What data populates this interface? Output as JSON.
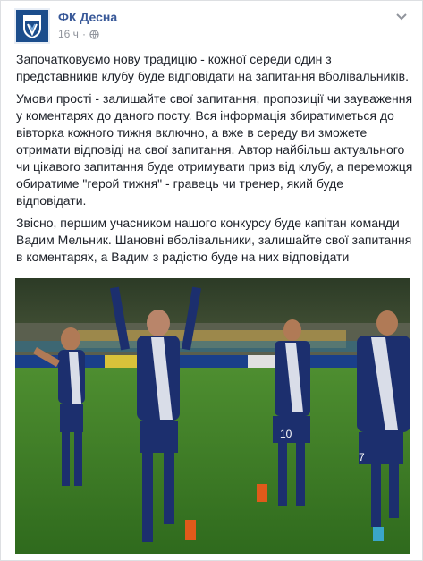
{
  "post": {
    "page_name": "ФК Десна",
    "timestamp": "16 ч",
    "privacy_icon": "globe-icon",
    "options_icon": "chevron-down-icon",
    "paragraphs": [
      "Започатковуємо нову традицію - кожної середи один з представників клубу буде відповідати на запитання вболівальників.",
      "Умови прості - залишайте свої запитання, пропозиції чи зауваження у коментарях до даного посту. Вся інформація збиратиметься до вівторка кожного тижня включно, а вже в середу ви зможете отримати відповіді на свої запитання. Автор найбільш актуального чи цікавого запитання буде отримувати приз від клубу, а переможця обиратиме \"герой тижня\" - гравець чи тренер, який буде відповідати.",
      "Звісно, першим учасником нашого конкурсу буде капітан команди Вадим Мельник. Шановні вболівальники, залишайте свої запитання в коментарях, а Вадим з радістю буде на них відповідати"
    ],
    "photo_numbers": [
      "10",
      "7"
    ]
  },
  "colors": {
    "link": "#385898",
    "kit_blue": "#1c2f6e",
    "pitch": "#3e7d2a"
  }
}
